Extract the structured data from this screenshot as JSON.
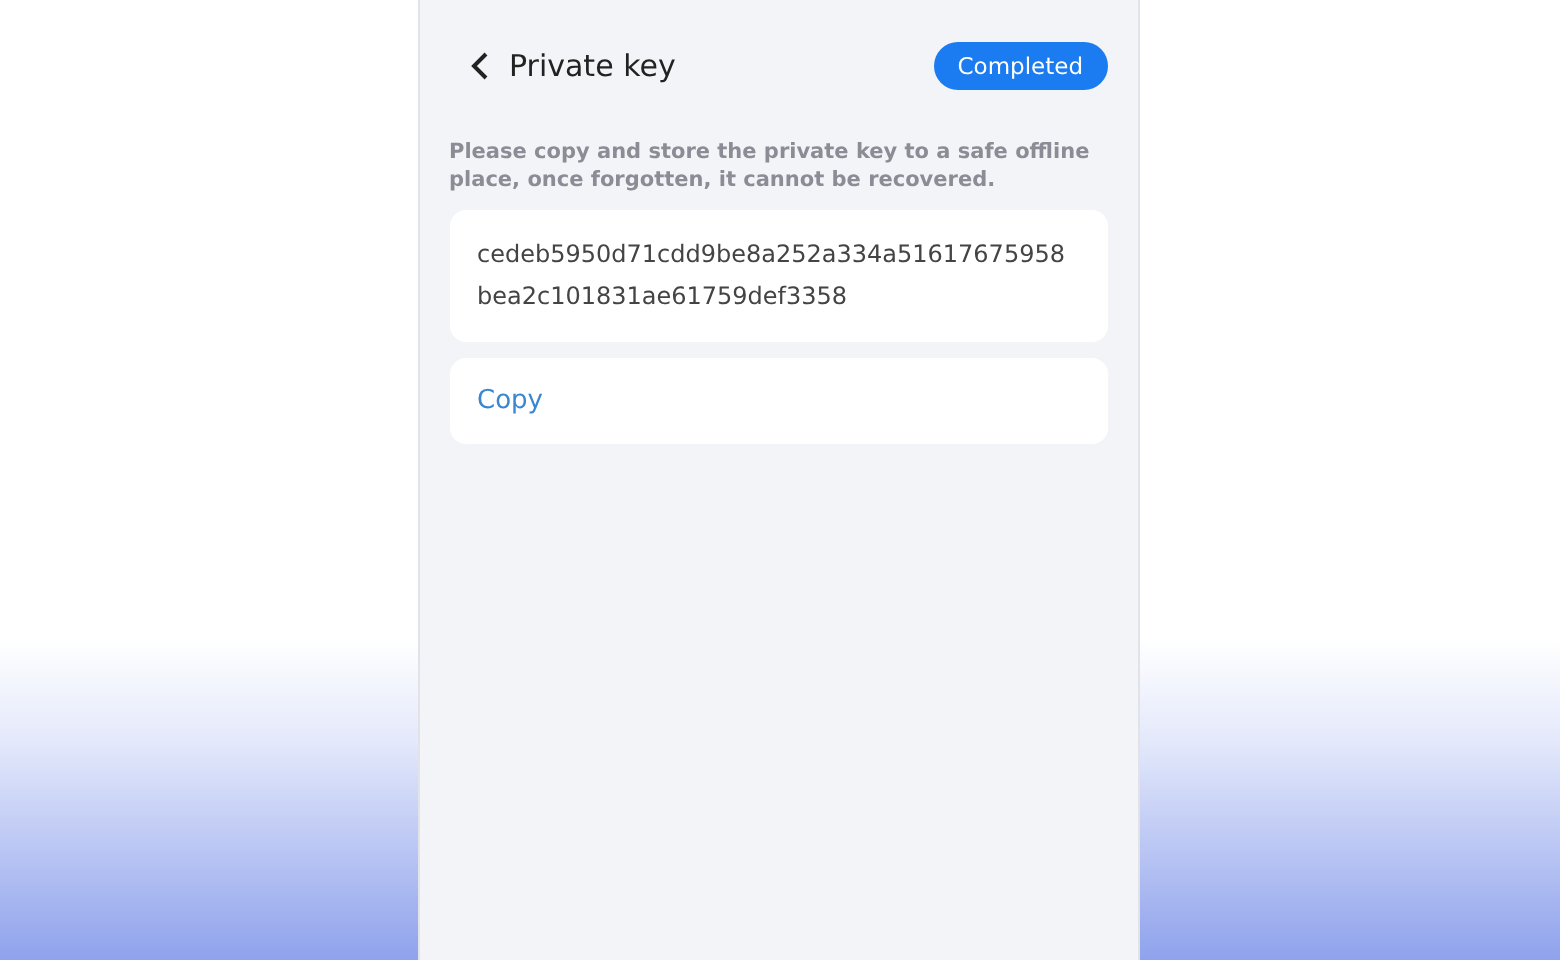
{
  "header": {
    "title": "Private key",
    "badge": "Completed"
  },
  "notice": "Please copy and store the private key to a safe offline place, once forgotten, it cannot be recovered.",
  "private_key": "cedeb5950d71cdd9be8a252a334a51617675958bea2c101831ae61759def3358",
  "copy_button": "Copy"
}
